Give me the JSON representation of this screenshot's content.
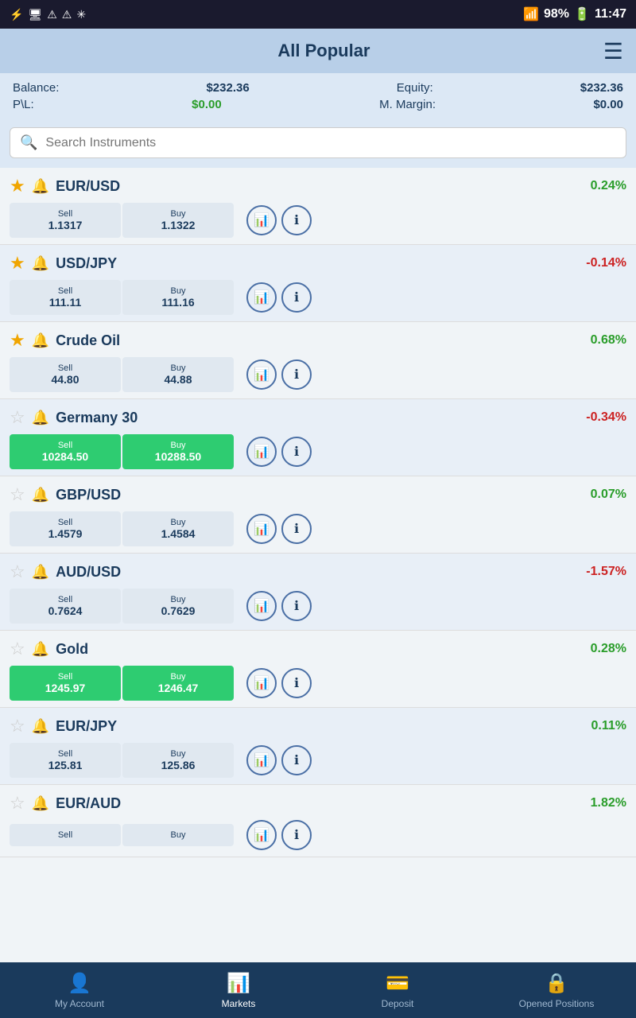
{
  "statusBar": {
    "time": "11:47",
    "battery": "98%"
  },
  "header": {
    "title": "All Popular"
  },
  "balance": {
    "balanceLabel": "Balance:",
    "balanceValue": "$232.36",
    "equityLabel": "Equity:",
    "equityValue": "$232.36",
    "plLabel": "P\\L:",
    "plValue": "$0.00",
    "marginLabel": "M. Margin:",
    "marginValue": "$0.00"
  },
  "search": {
    "placeholder": "Search Instruments"
  },
  "instruments": [
    {
      "name": "EUR/USD",
      "pct": "0.24%",
      "pctSign": "green",
      "starred": true,
      "sellLabel": "Sell",
      "sellValue": "1.1317",
      "buyLabel": "Buy",
      "buyValue": "1.1322",
      "btnStyle": "default"
    },
    {
      "name": "USD/JPY",
      "pct": "-0.14%",
      "pctSign": "red",
      "starred": true,
      "sellLabel": "Sell",
      "sellValue": "111.11",
      "buyLabel": "Buy",
      "buyValue": "111.16",
      "btnStyle": "default"
    },
    {
      "name": "Crude Oil",
      "pct": "0.68%",
      "pctSign": "green",
      "starred": true,
      "sellLabel": "Sell",
      "sellValue": "44.80",
      "buyLabel": "Buy",
      "buyValue": "44.88",
      "btnStyle": "default"
    },
    {
      "name": "Germany 30",
      "pct": "-0.34%",
      "pctSign": "red",
      "starred": false,
      "sellLabel": "Sell",
      "sellValue": "10284.50",
      "buyLabel": "Buy",
      "buyValue": "10288.50",
      "btnStyle": "green"
    },
    {
      "name": "GBP/USD",
      "pct": "0.07%",
      "pctSign": "green",
      "starred": false,
      "sellLabel": "Sell",
      "sellValue": "1.4579",
      "buyLabel": "Buy",
      "buyValue": "1.4584",
      "btnStyle": "default"
    },
    {
      "name": "AUD/USD",
      "pct": "-1.57%",
      "pctSign": "red",
      "starred": false,
      "sellLabel": "Sell",
      "sellValue": "0.7624",
      "buyLabel": "Buy",
      "buyValue": "0.7629",
      "btnStyle": "default"
    },
    {
      "name": "Gold",
      "pct": "0.28%",
      "pctSign": "green",
      "starred": false,
      "sellLabel": "Sell",
      "sellValue": "1245.97",
      "buyLabel": "Buy",
      "buyValue": "1246.47",
      "btnStyle": "green"
    },
    {
      "name": "EUR/JPY",
      "pct": "0.11%",
      "pctSign": "green",
      "starred": false,
      "sellLabel": "Sell",
      "sellValue": "125.81",
      "buyLabel": "Buy",
      "buyValue": "125.86",
      "btnStyle": "default"
    },
    {
      "name": "EUR/AUD",
      "pct": "1.82%",
      "pctSign": "green",
      "starred": false,
      "sellLabel": "Sell",
      "sellValue": "",
      "buyLabel": "Buy",
      "buyValue": "",
      "btnStyle": "default"
    }
  ],
  "bottomNav": [
    {
      "id": "my-account",
      "label": "My Account",
      "icon": "👤",
      "active": false
    },
    {
      "id": "markets",
      "label": "Markets",
      "icon": "📊",
      "active": true
    },
    {
      "id": "deposit",
      "label": "Deposit",
      "icon": "💳",
      "active": false
    },
    {
      "id": "opened-positions",
      "label": "Opened Positions",
      "icon": "🔒",
      "active": false
    }
  ]
}
